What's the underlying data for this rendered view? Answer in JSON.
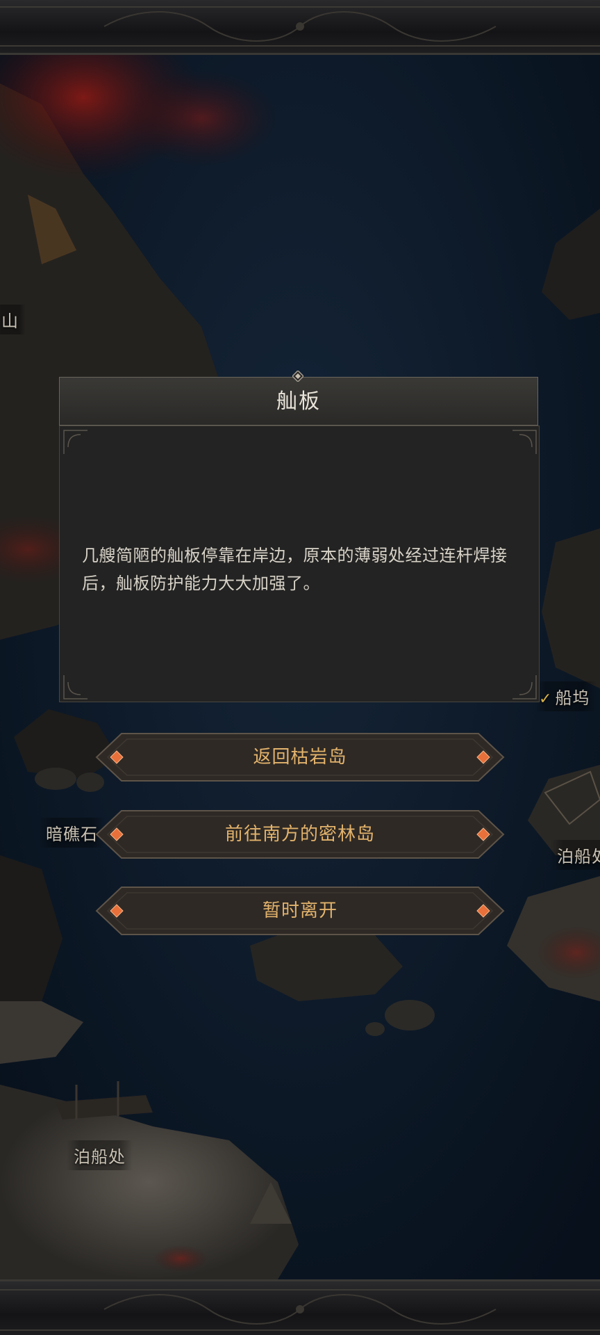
{
  "map": {
    "labels": [
      {
        "id": "mountain",
        "text": "山"
      },
      {
        "id": "dock-right",
        "text": "船坞"
      },
      {
        "id": "reef-left",
        "text": "暗礁石"
      },
      {
        "id": "anchorage-right",
        "text": "泊船处"
      },
      {
        "id": "anchorage-bottom",
        "text": "泊船处"
      }
    ]
  },
  "dialog": {
    "title": "舢板",
    "description": "几艘简陋的舢板停靠在岸边，原本的薄弱处经过连杆焊接后，舢板防护能力大大加强了。"
  },
  "options": [
    {
      "label": "返回枯岩岛"
    },
    {
      "label": "前往南方的密林岛"
    },
    {
      "label": "暂时离开"
    }
  ],
  "colors": {
    "option_text": "#e3b36c",
    "gem": "#e8703a",
    "dialog_body": "#232323",
    "sea": "#0d1826"
  }
}
